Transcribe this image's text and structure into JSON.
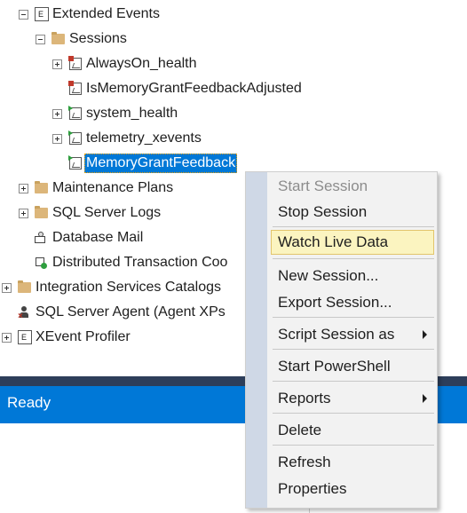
{
  "tree": {
    "extended_events": "Extended Events",
    "sessions": "Sessions",
    "session_alwayson": "AlwaysOn_health",
    "session_ismemory": "IsMemoryGrantFeedbackAdjusted",
    "session_system_health": "system_health",
    "session_telemetry": "telemetry_xevents",
    "session_selected": "MemoryGrantFeedback",
    "maintenance_plans": "Maintenance Plans",
    "sql_server_logs": "SQL Server Logs",
    "database_mail": "Database Mail",
    "distributed_txn": "Distributed Transaction Coo",
    "integration_services": "Integration Services Catalogs",
    "sql_agent": "SQL Server Agent (Agent XPs",
    "xevent_profiler": "XEvent Profiler"
  },
  "context_menu": {
    "start_session": "Start Session",
    "stop_session": "Stop Session",
    "watch_live_data": "Watch Live Data",
    "new_session": "New Session...",
    "export_session": "Export Session...",
    "script_session_as": "Script Session as",
    "start_powershell": "Start PowerShell",
    "reports": "Reports",
    "delete": "Delete",
    "refresh": "Refresh",
    "properties": "Properties"
  },
  "status_bar": {
    "text": "Ready"
  },
  "colors": {
    "selection": "#0078d7",
    "status_bar": "#0078d7",
    "menu_highlight": "#fbf4c0",
    "running_indicator": "#2e9e3e",
    "stopped_indicator": "#c0392b"
  }
}
